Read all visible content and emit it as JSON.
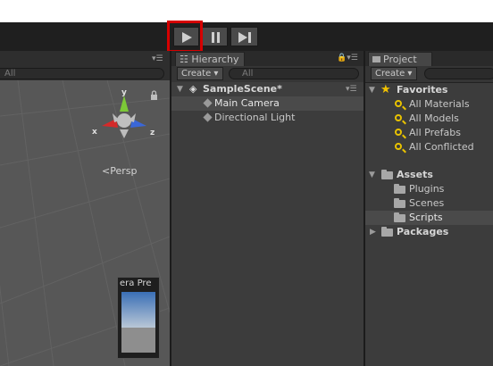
{
  "toolbar": {
    "play_icon": "play-icon",
    "pause_icon": "pause-icon",
    "step_icon": "step-icon"
  },
  "scene_view": {
    "search_placeholder": "All",
    "gizmo": {
      "y": "y",
      "x": "x",
      "z": "z"
    },
    "persp_label": "Persp",
    "camera_preview_label": "era Pre"
  },
  "hierarchy": {
    "tab_label": "Hierarchy",
    "create_label": "Create",
    "search_placeholder": "All",
    "scene_name": "SampleScene*",
    "items": [
      {
        "label": "Main Camera",
        "selected": true
      },
      {
        "label": "Directional Light",
        "selected": false
      }
    ]
  },
  "project": {
    "tab_label": "Project",
    "create_label": "Create",
    "favorites": {
      "label": "Favorites",
      "items": [
        "All Materials",
        "All Models",
        "All Prefabs",
        "All Conflicted"
      ]
    },
    "assets": {
      "label": "Assets",
      "items": [
        {
          "label": "Plugins",
          "selected": false
        },
        {
          "label": "Scenes",
          "selected": false
        },
        {
          "label": "Scripts",
          "selected": true
        }
      ]
    },
    "packages_label": "Packages"
  },
  "colors": {
    "highlight": "#d60000",
    "favorite_star": "#f2c200",
    "gizmo_y": "#7cc837",
    "gizmo_x": "#d42a2a",
    "gizmo_z": "#3a67d8"
  }
}
